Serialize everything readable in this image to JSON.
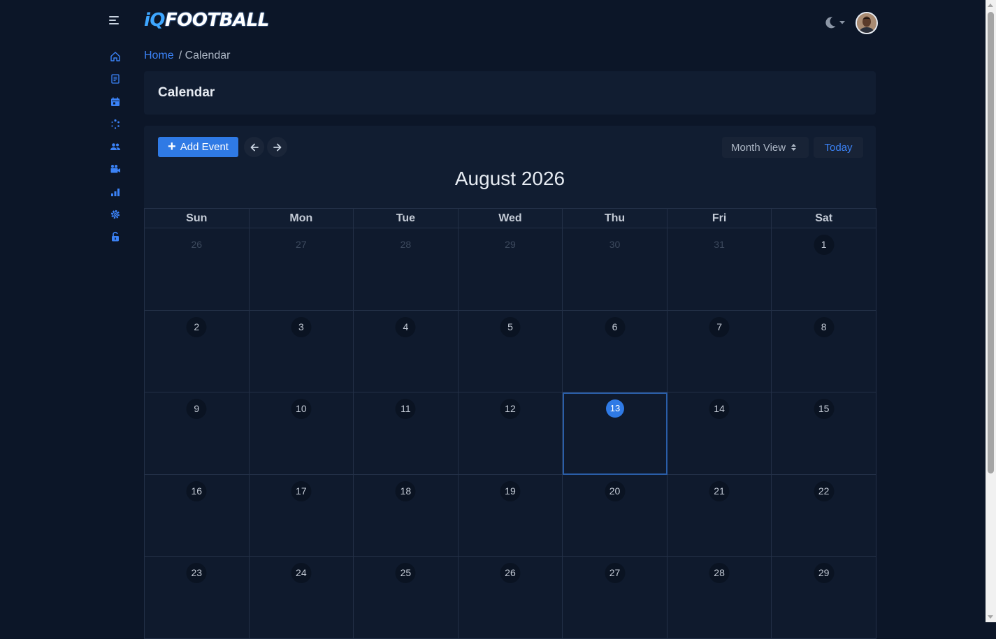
{
  "app": {
    "logo_prefix": "iQ",
    "logo_main": "FOOTBALL"
  },
  "sidebar": {
    "items": [
      {
        "icon": "home-icon"
      },
      {
        "icon": "document-icon"
      },
      {
        "icon": "calendar-icon"
      },
      {
        "icon": "dots-spinner-icon"
      },
      {
        "icon": "users-icon"
      },
      {
        "icon": "video-camera-icon"
      },
      {
        "icon": "bar-chart-icon"
      },
      {
        "icon": "gear-icon"
      },
      {
        "icon": "lock-open-icon"
      }
    ]
  },
  "breadcrumb": {
    "home": "Home",
    "current": "/ Calendar"
  },
  "page": {
    "title": "Calendar"
  },
  "toolbar": {
    "add_event_label": "Add Event",
    "view_label": "Month View",
    "today_label": "Today"
  },
  "calendar": {
    "month_title": "August 2026",
    "weekdays": [
      "Sun",
      "Mon",
      "Tue",
      "Wed",
      "Thu",
      "Fri",
      "Sat"
    ],
    "weeks": [
      [
        "26",
        "27",
        "28",
        "29",
        "30",
        "31",
        "1"
      ],
      [
        "2",
        "3",
        "4",
        "5",
        "6",
        "7",
        "8"
      ],
      [
        "9",
        "10",
        "11",
        "12",
        "13",
        "14",
        "15"
      ],
      [
        "16",
        "17",
        "18",
        "19",
        "20",
        "21",
        "22"
      ],
      [
        "23",
        "24",
        "25",
        "26",
        "27",
        "28",
        "29"
      ]
    ],
    "today": "13"
  },
  "colors": {
    "accent": "#2f7ae5",
    "link": "#3b82f6",
    "background": "#0c1628",
    "card": "#111d31"
  }
}
